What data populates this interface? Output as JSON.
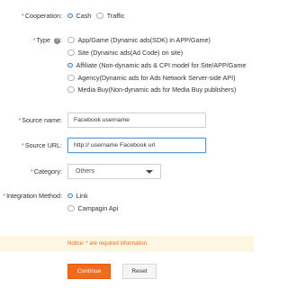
{
  "cooperation": {
    "label": "Cooperation:",
    "options": [
      "Cash",
      "Traffic"
    ],
    "selected": "Cash"
  },
  "type": {
    "label": "Type",
    "help_glyph": "?",
    "options": [
      "App/Game (Dynamic ads(SDK) in APP/Game)",
      "Site (Dynamic ads(Ad Code) on site)",
      "Affiliate (Non-dynamic ads & CPI model for Site/APP/Game",
      "Agency(Dynamic ads for Ads Network Server-side API)",
      "Media Buy(Non-dynamic ads for Media Buy publishers)"
    ],
    "selected": "Affiliate (Non-dynamic ads & CPI model for Site/APP/Game"
  },
  "source_name": {
    "label": "Source name:",
    "value": "Facebook username"
  },
  "source_url": {
    "label": "Source URL:",
    "value": "http:// username Facebook url"
  },
  "category": {
    "label": "Category:",
    "value": "Others"
  },
  "integration_method": {
    "label": "Integration Method:",
    "options": [
      "Link",
      "Campagin Api"
    ],
    "selected": "Link"
  },
  "notice": "Notice: * are required information.",
  "buttons": {
    "continue": "Continue",
    "reset": "Reset"
  },
  "colors": {
    "accent": "#3a85d6",
    "required": "#e8474b",
    "primary_button": "#f26a1b",
    "notice_bg": "#fdf6e3"
  }
}
